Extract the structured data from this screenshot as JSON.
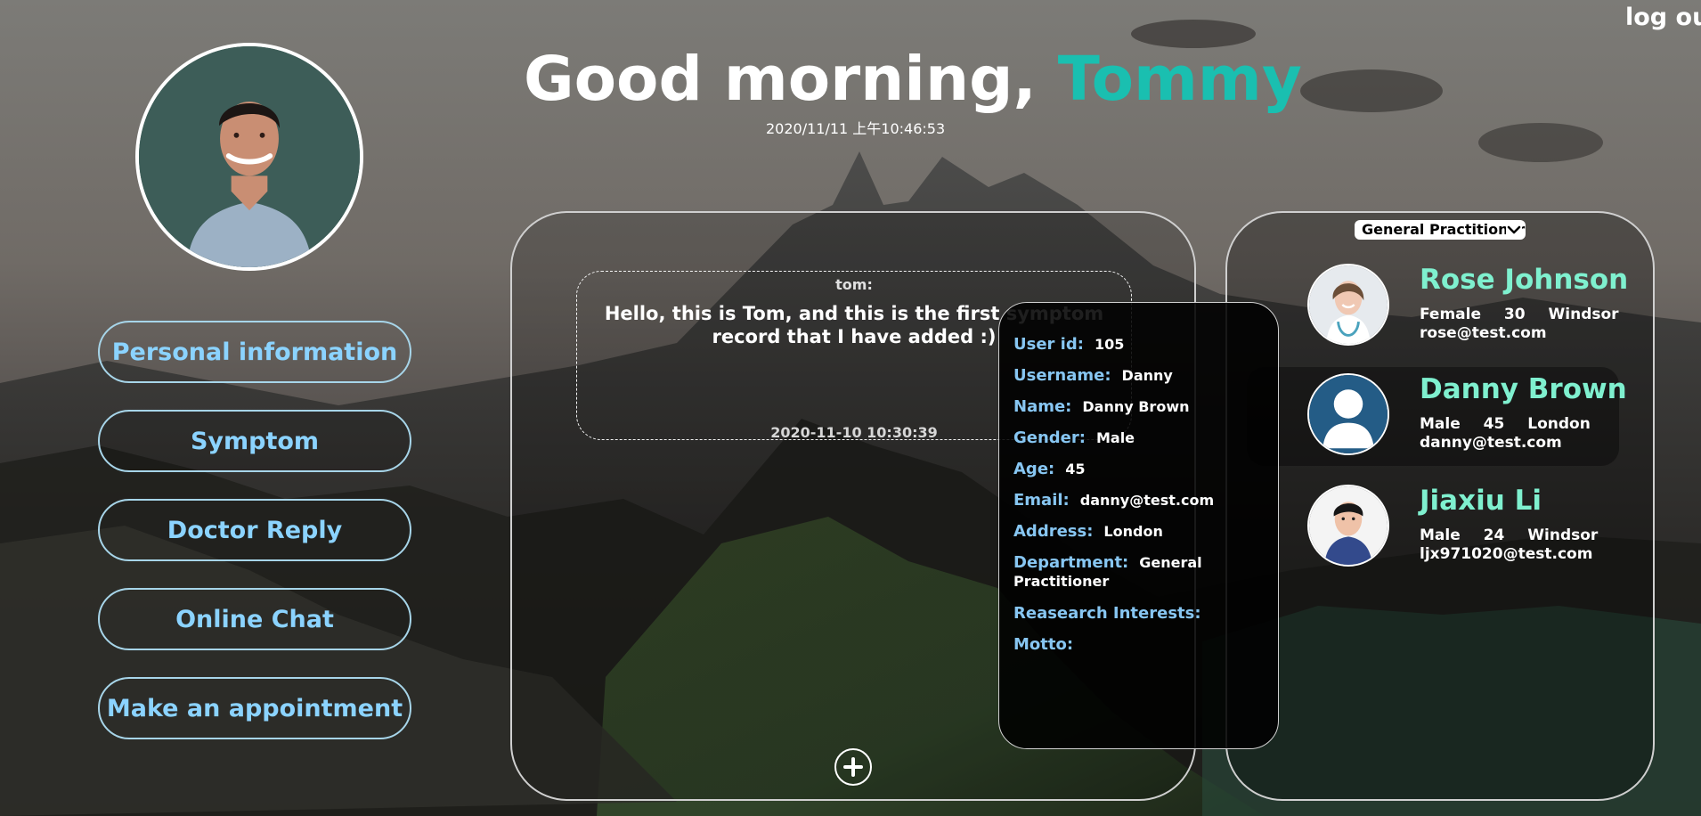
{
  "header": {
    "logout_label": "log out",
    "greeting_prefix": "Good morning, ",
    "user_name": "Tommy",
    "datetime": "2020/11/11 上午10:46:53"
  },
  "sidebar": {
    "items": [
      {
        "label": "Personal information"
      },
      {
        "label": "Symptom"
      },
      {
        "label": "Doctor Reply"
      },
      {
        "label": "Online Chat"
      },
      {
        "label": "Make an appointment"
      }
    ]
  },
  "symptom": {
    "author": "tom:",
    "content": "Hello, this is Tom, and this is the first symptom record that I have added :)",
    "timestamp": "2020-11-10 10:30:39"
  },
  "doctors": {
    "department_selected": "General Practitioner",
    "list": [
      {
        "name": "Rose Johnson",
        "gender": "Female",
        "age": "30",
        "city": "Windsor",
        "email": "rose@test.com"
      },
      {
        "name": "Danny Brown",
        "gender": "Male",
        "age": "45",
        "city": "London",
        "email": "danny@test.com"
      },
      {
        "name": "Jiaxiu Li",
        "gender": "Male",
        "age": "24",
        "city": "Windsor",
        "email": "ljx971020@test.com"
      }
    ]
  },
  "profile": {
    "user_id_label": "User id:",
    "user_id": "105",
    "username_label": "Username:",
    "username": "Danny",
    "name_label": "Name:",
    "name": "Danny Brown",
    "gender_label": "Gender:",
    "gender": "Male",
    "age_label": "Age:",
    "age": "45",
    "email_label": "Email:",
    "email": "danny@test.com",
    "address_label": "Address:",
    "address": "London",
    "department_label": "Department:",
    "department": "General Practitioner",
    "research_label": "Reasearch Interests:",
    "motto_label": "Motto:"
  },
  "colors": {
    "accent_name": "#1abfb0",
    "nav_text": "#8bd3ff",
    "doctor_name": "#7ff0cf",
    "profile_label": "#87c6f2"
  },
  "icons": {
    "user_avatar": "portrait-avatar",
    "rose_avatar": "doctor-portrait-avatar",
    "danny_avatar": "default-user-icon",
    "jiaxiu_avatar": "portrait-avatar",
    "add": "plus-icon",
    "dropdown": "chevron-down-icon"
  }
}
